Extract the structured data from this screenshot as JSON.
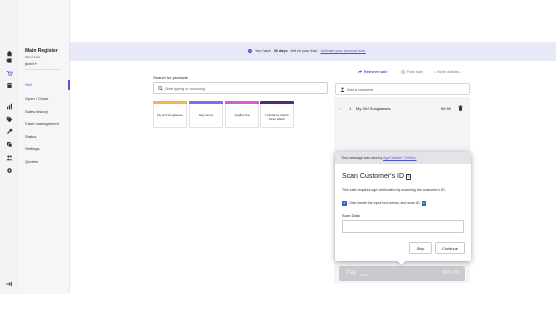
{
  "colors": {
    "accent": "#5b4fd6",
    "link": "#4b58c9",
    "banner_bg": "#e8e9f8",
    "tile_bars": [
      "#f2b552",
      "#7a6ef0",
      "#d65ad6",
      "#5a2a7a"
    ]
  },
  "rail": {
    "icons": [
      "home-icon",
      "register-icon",
      "sales-icon",
      "reports-icon",
      "tags-icon",
      "tools-icon",
      "products-icon",
      "customers-icon",
      "settings-icon",
      "logout-icon"
    ]
  },
  "register": {
    "title": "Main Register",
    "outlet": "Main Outlet",
    "user": "jkoibit"
  },
  "menu": {
    "items": [
      "Sell",
      "Open / Close",
      "Sales history",
      "Cash management",
      "Status",
      "Settings",
      "Quotes"
    ]
  },
  "banner": {
    "prefix": "You have",
    "days": "30 days",
    "suffix": "left on your trial.",
    "link": "Activate your account now."
  },
  "search": {
    "label": "Search for products",
    "placeholder": "Start typing or scanning"
  },
  "tiles": [
    {
      "name": "My Girl Sunglasses"
    },
    {
      "name": "Italy Grous"
    },
    {
      "name": "Asgård Tea"
    },
    {
      "name": "Lollobarne Hilash Strap Watch"
    }
  ],
  "actions": {
    "retrieve": "Retrieve sale",
    "park": "Park sale",
    "more": "More actions..."
  },
  "customer": {
    "placeholder": "Add a customer"
  },
  "sale": {
    "line_items": [
      {
        "qty": "1",
        "name": "My Girl Sunglasses",
        "price": "69.90"
      }
    ],
    "pay_label": "Pay",
    "items_label": "1 item",
    "total": "$69.90"
  },
  "dialog": {
    "sender_prefix": "This message was sent by",
    "sender_link": "AgeChecker 71990ix.",
    "title": "Scan Customer's ID",
    "description": "This sale requires age verification by scanning the customer's ID.",
    "step_number": "1",
    "step_text": "Click inside the input box below, and scan ID",
    "step_end": "2",
    "field_label": "Scan Data",
    "field_value": "",
    "skip_label": "Skip",
    "continue_label": "Continue"
  }
}
